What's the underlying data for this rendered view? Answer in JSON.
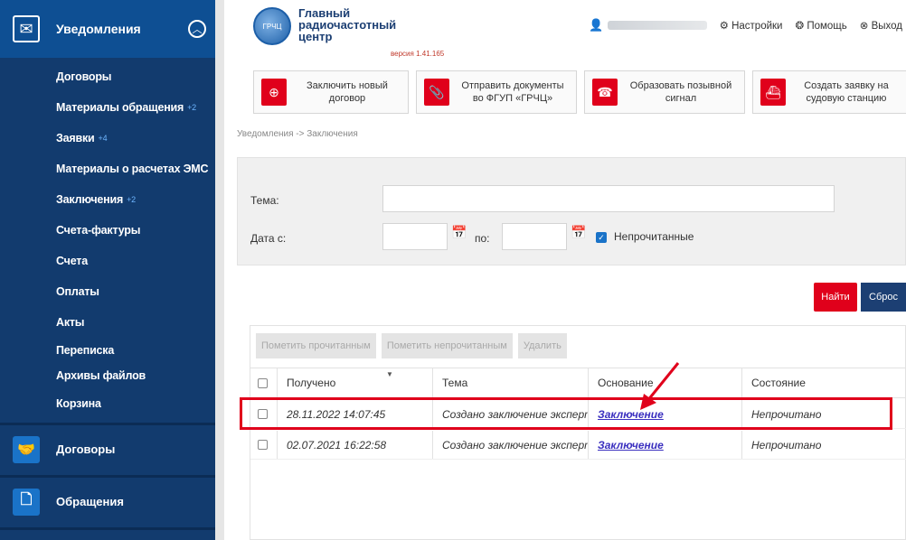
{
  "sidebar": {
    "header_title": "Уведомления",
    "sub_items": [
      {
        "label": "Договоры",
        "badge": ""
      },
      {
        "label": "Материалы обращения",
        "badge": "+2"
      },
      {
        "label": "Заявки",
        "badge": "+4"
      },
      {
        "label": "Материалы о расчетах ЭМС",
        "badge": ""
      },
      {
        "label": "Заключения",
        "badge": "+2"
      },
      {
        "label": "Счета-фактуры",
        "badge": ""
      },
      {
        "label": "Счета",
        "badge": ""
      },
      {
        "label": "Оплаты",
        "badge": ""
      },
      {
        "label": "Акты",
        "badge": ""
      },
      {
        "label": "Переписка",
        "badge": ""
      },
      {
        "label": "Архивы файлов",
        "badge": ""
      },
      {
        "label": "Корзина",
        "badge": ""
      }
    ],
    "main_items": [
      {
        "label": "Договоры",
        "icon": "handshake-icon"
      },
      {
        "label": "Обращения",
        "icon": "document-icon"
      }
    ]
  },
  "header": {
    "logo_line1": "Главный",
    "logo_line2": "радиочастотный",
    "logo_line3": "центр",
    "logo_badge": "ГРЧЦ",
    "version": "версия 1.41.165",
    "settings": "Настройки",
    "help": "Помощь",
    "logout": "Выход"
  },
  "actions": [
    {
      "line1": "Заключить новый",
      "line2": "договор"
    },
    {
      "line1": "Отправить документы",
      "line2": "во ФГУП «ГРЧЦ»"
    },
    {
      "line1": "Образовать позывной",
      "line2": "сигнал"
    },
    {
      "line1": "Создать заявку на",
      "line2": "судовую станцию"
    }
  ],
  "breadcrumb": "Уведомления -> Заключения",
  "filter": {
    "topic_label": "Тема:",
    "date_from_label": "Дата с:",
    "date_to_label": "по:",
    "unread_label": "Непрочитанные"
  },
  "buttons": {
    "find": "Найти",
    "reset": "Сброс"
  },
  "table": {
    "toolbar": [
      "Пометить прочитанным",
      "Пометить непрочитанным",
      "Удалить"
    ],
    "columns": [
      "Получено",
      "Тема",
      "Основание",
      "Состояние"
    ],
    "rows": [
      {
        "received": "28.11.2022 14:07:45",
        "topic": "Создано заключение эксперт...",
        "basis": "Заключение",
        "status": "Непрочитано"
      },
      {
        "received": "02.07.2021 16:22:58",
        "topic": "Создано заключение эксперт...",
        "basis": "Заключение",
        "status": "Непрочитано"
      }
    ]
  },
  "colors": {
    "accent_red": "#e0001b",
    "sidebar_bg": "#123b6e",
    "link": "#3a2fbf"
  }
}
